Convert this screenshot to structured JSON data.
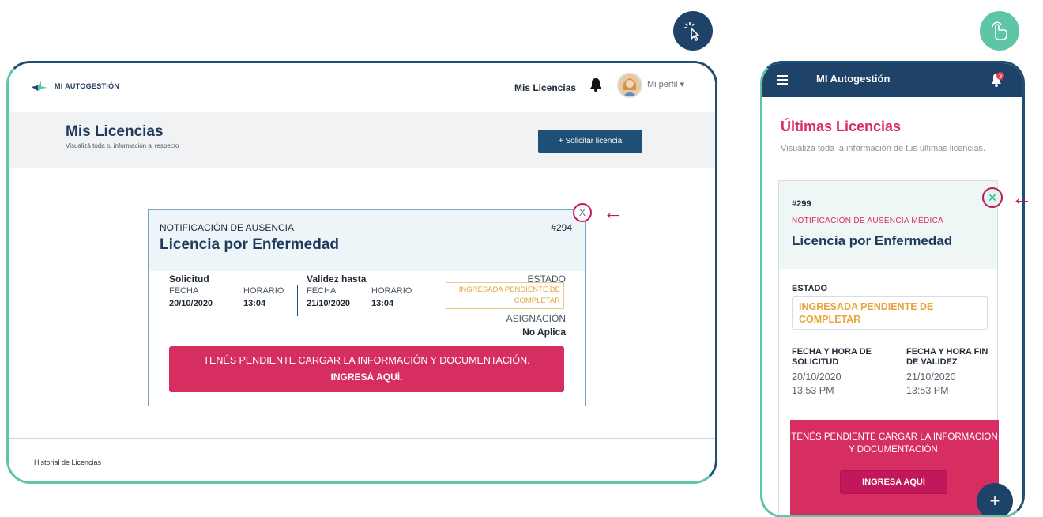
{
  "desktop": {
    "logo_text": "MI AUTOGESTIÓN",
    "nav_link": "Mis Licencias",
    "profile_label": "Mi perfil ▾",
    "page_title": "Mis Licencias",
    "page_subtitle": "Visualizá toda tu información al respecto",
    "solicit_button": "+ Solicitar licencia",
    "card": {
      "type": "NOTIFICACIÓN DE AUSENCIA",
      "id": "#294",
      "title": "Licencia por Enfermedad",
      "solicitud_label": "Solicitud",
      "validez_label": "Validez hasta",
      "fecha_label": "FECHA",
      "horario_label": "HORARIO",
      "solicitud_fecha": "20/10/2020",
      "solicitud_horario": "13:04",
      "validez_fecha": "21/10/2020",
      "validez_horario": "13:04",
      "estado_label": "ESTADO",
      "estado_value": "INGRESADA PENDIENTE DE COMPLETAR",
      "asignacion_label": "ASIGNACIÓN",
      "asignacion_value": "No Aplica",
      "alert_line1": "TENÉS PENDIENTE CARGAR LA INFORMACIÓN Y DOCUMENTACIÓN.",
      "alert_line2": "INGRESÁ AQUÍ.",
      "close_label": "X"
    },
    "footer_link": "Historial de Licencias"
  },
  "mobile": {
    "header_title": "MI Autogestión",
    "notification_count": "3",
    "heading": "Últimas Licencias",
    "subheading": "Visualizá toda la información de tus últimas licencias.",
    "card": {
      "id": "#299",
      "type": "NOTIFICACIÓN DE AUSENCIA MÉDICA",
      "title": "Licencia por Enfermedad",
      "estado_label": "ESTADO",
      "estado_value": "INGRESADA PENDIENTE DE COMPLETAR",
      "col1_label": "FECHA Y HORA DE SOLICITUD",
      "col1_date": "20/10/2020",
      "col1_time": "13:53 PM",
      "col2_label": "FECHA Y HORA FIN DE VALIDEZ",
      "col2_date": "21/10/2020",
      "col2_time": "13:53 PM",
      "alert_text": "TENÉS PENDIENTE CARGAR LA INFORMACIÓN Y DOCUMENTACIÓN.",
      "alert_button": "INGRESA AQUÍ",
      "close_label": "✕"
    },
    "fab_label": "+"
  },
  "icons": {
    "click_badge": "cursor-click-icon",
    "touch_badge": "hand-touch-icon",
    "arrow": "←"
  },
  "colors": {
    "primary": "#1f4268",
    "accent": "#d72e62",
    "teal": "#5ec5a6",
    "warning": "#e8a33d"
  }
}
